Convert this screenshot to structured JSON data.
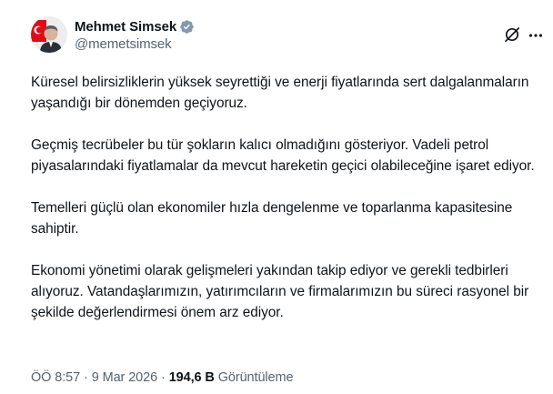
{
  "author": {
    "display_name": "Mehmet Simsek",
    "handle": "@memetsimsek",
    "verified": true,
    "verified_color": "#829aab"
  },
  "tweet": {
    "paragraphs": [
      "Küresel belirsizliklerin yüksek seyrettiği ve enerji fiyatlarında sert dalgalanmaların yaşandığı bir dönemden geçiyoruz.",
      "Geçmiş tecrübeler bu tür şokların kalıcı olmadığını gösteriyor. Vadeli petrol piyasalarındaki fiyatlamalar da mevcut hareketin geçici olabileceğine işaret ediyor.",
      "Temelleri güçlü olan ekonomiler hızla dengelenme ve toparlanma kapasitesine sahiptir.",
      "Ekonomi yönetimi olarak gelişmeleri yakından takip ediyor ve gerekli tedbirleri alıyoruz. Vatandaşlarımızın, yatırımcıların ve firmalarımızın bu süreci rasyonel bir şekilde değerlendirmesi önem arz ediyor."
    ]
  },
  "meta": {
    "time": "ÖÖ 8:57",
    "separator": "·",
    "date": "9 Mar 2026",
    "views_count": "194,6 B",
    "views_label": "Görüntüleme"
  },
  "icons": {
    "grok": "grok-icon",
    "more": "more-icon",
    "verified": "verified-badge-icon"
  },
  "colors": {
    "text_primary": "#0f1419",
    "text_secondary": "#536471",
    "badge": "#829aab",
    "avatar_flag_red": "#e30a17"
  }
}
